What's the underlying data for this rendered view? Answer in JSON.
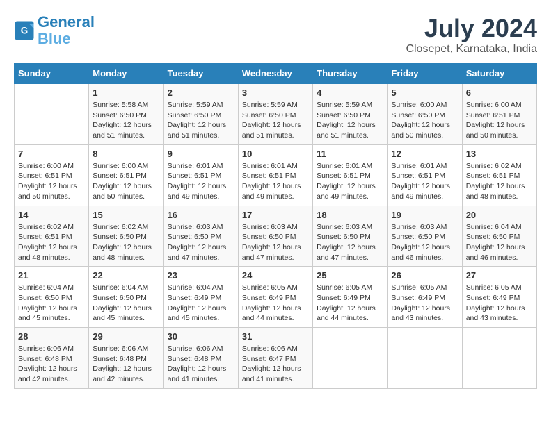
{
  "header": {
    "logo_line1": "General",
    "logo_line2": "Blue",
    "title": "July 2024",
    "subtitle": "Closepet, Karnataka, India"
  },
  "weekdays": [
    "Sunday",
    "Monday",
    "Tuesday",
    "Wednesday",
    "Thursday",
    "Friday",
    "Saturday"
  ],
  "weeks": [
    [
      {
        "day": "",
        "info": ""
      },
      {
        "day": "1",
        "info": "Sunrise: 5:58 AM\nSunset: 6:50 PM\nDaylight: 12 hours\nand 51 minutes."
      },
      {
        "day": "2",
        "info": "Sunrise: 5:59 AM\nSunset: 6:50 PM\nDaylight: 12 hours\nand 51 minutes."
      },
      {
        "day": "3",
        "info": "Sunrise: 5:59 AM\nSunset: 6:50 PM\nDaylight: 12 hours\nand 51 minutes."
      },
      {
        "day": "4",
        "info": "Sunrise: 5:59 AM\nSunset: 6:50 PM\nDaylight: 12 hours\nand 51 minutes."
      },
      {
        "day": "5",
        "info": "Sunrise: 6:00 AM\nSunset: 6:50 PM\nDaylight: 12 hours\nand 50 minutes."
      },
      {
        "day": "6",
        "info": "Sunrise: 6:00 AM\nSunset: 6:51 PM\nDaylight: 12 hours\nand 50 minutes."
      }
    ],
    [
      {
        "day": "7",
        "info": "Sunrise: 6:00 AM\nSunset: 6:51 PM\nDaylight: 12 hours\nand 50 minutes."
      },
      {
        "day": "8",
        "info": "Sunrise: 6:00 AM\nSunset: 6:51 PM\nDaylight: 12 hours\nand 50 minutes."
      },
      {
        "day": "9",
        "info": "Sunrise: 6:01 AM\nSunset: 6:51 PM\nDaylight: 12 hours\nand 49 minutes."
      },
      {
        "day": "10",
        "info": "Sunrise: 6:01 AM\nSunset: 6:51 PM\nDaylight: 12 hours\nand 49 minutes."
      },
      {
        "day": "11",
        "info": "Sunrise: 6:01 AM\nSunset: 6:51 PM\nDaylight: 12 hours\nand 49 minutes."
      },
      {
        "day": "12",
        "info": "Sunrise: 6:01 AM\nSunset: 6:51 PM\nDaylight: 12 hours\nand 49 minutes."
      },
      {
        "day": "13",
        "info": "Sunrise: 6:02 AM\nSunset: 6:51 PM\nDaylight: 12 hours\nand 48 minutes."
      }
    ],
    [
      {
        "day": "14",
        "info": "Sunrise: 6:02 AM\nSunset: 6:51 PM\nDaylight: 12 hours\nand 48 minutes."
      },
      {
        "day": "15",
        "info": "Sunrise: 6:02 AM\nSunset: 6:50 PM\nDaylight: 12 hours\nand 48 minutes."
      },
      {
        "day": "16",
        "info": "Sunrise: 6:03 AM\nSunset: 6:50 PM\nDaylight: 12 hours\nand 47 minutes."
      },
      {
        "day": "17",
        "info": "Sunrise: 6:03 AM\nSunset: 6:50 PM\nDaylight: 12 hours\nand 47 minutes."
      },
      {
        "day": "18",
        "info": "Sunrise: 6:03 AM\nSunset: 6:50 PM\nDaylight: 12 hours\nand 47 minutes."
      },
      {
        "day": "19",
        "info": "Sunrise: 6:03 AM\nSunset: 6:50 PM\nDaylight: 12 hours\nand 46 minutes."
      },
      {
        "day": "20",
        "info": "Sunrise: 6:04 AM\nSunset: 6:50 PM\nDaylight: 12 hours\nand 46 minutes."
      }
    ],
    [
      {
        "day": "21",
        "info": "Sunrise: 6:04 AM\nSunset: 6:50 PM\nDaylight: 12 hours\nand 45 minutes."
      },
      {
        "day": "22",
        "info": "Sunrise: 6:04 AM\nSunset: 6:50 PM\nDaylight: 12 hours\nand 45 minutes."
      },
      {
        "day": "23",
        "info": "Sunrise: 6:04 AM\nSunset: 6:49 PM\nDaylight: 12 hours\nand 45 minutes."
      },
      {
        "day": "24",
        "info": "Sunrise: 6:05 AM\nSunset: 6:49 PM\nDaylight: 12 hours\nand 44 minutes."
      },
      {
        "day": "25",
        "info": "Sunrise: 6:05 AM\nSunset: 6:49 PM\nDaylight: 12 hours\nand 44 minutes."
      },
      {
        "day": "26",
        "info": "Sunrise: 6:05 AM\nSunset: 6:49 PM\nDaylight: 12 hours\nand 43 minutes."
      },
      {
        "day": "27",
        "info": "Sunrise: 6:05 AM\nSunset: 6:49 PM\nDaylight: 12 hours\nand 43 minutes."
      }
    ],
    [
      {
        "day": "28",
        "info": "Sunrise: 6:06 AM\nSunset: 6:48 PM\nDaylight: 12 hours\nand 42 minutes."
      },
      {
        "day": "29",
        "info": "Sunrise: 6:06 AM\nSunset: 6:48 PM\nDaylight: 12 hours\nand 42 minutes."
      },
      {
        "day": "30",
        "info": "Sunrise: 6:06 AM\nSunset: 6:48 PM\nDaylight: 12 hours\nand 41 minutes."
      },
      {
        "day": "31",
        "info": "Sunrise: 6:06 AM\nSunset: 6:47 PM\nDaylight: 12 hours\nand 41 minutes."
      },
      {
        "day": "",
        "info": ""
      },
      {
        "day": "",
        "info": ""
      },
      {
        "day": "",
        "info": ""
      }
    ]
  ]
}
